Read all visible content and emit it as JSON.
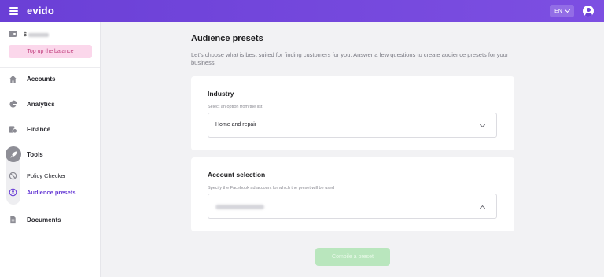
{
  "header": {
    "logo": "evido",
    "language": "EN"
  },
  "sidebar": {
    "balance_currency": "$",
    "top_up_label": "Top up the balance",
    "items": [
      {
        "label": "Accounts",
        "icon": "home-icon"
      },
      {
        "label": "Analytics",
        "icon": "pie-chart-icon"
      },
      {
        "label": "Finance",
        "icon": "finance-icon"
      },
      {
        "label": "Tools",
        "icon": "rocket-icon"
      },
      {
        "label": "Policy Checker",
        "icon": "block-icon"
      },
      {
        "label": "Audience presets",
        "icon": "audience-icon",
        "active": true
      },
      {
        "label": "Documents",
        "icon": "document-icon"
      }
    ]
  },
  "main": {
    "title": "Audience presets",
    "description": "Let's choose what is best suited for finding customers for you. Answer a few questions to create audience presets for your business.",
    "industry": {
      "title": "Industry",
      "hint": "Select an option from the list",
      "value": "Home and repair"
    },
    "account": {
      "title": "Account selection",
      "hint": "Specify the Facebook ad account for which the preset will be used"
    },
    "compile_label": "Compile a preset"
  },
  "colors": {
    "accent": "#6a3fd6",
    "topup_bg": "#fbd7eb",
    "compile_bg": "#b9e6bd"
  }
}
